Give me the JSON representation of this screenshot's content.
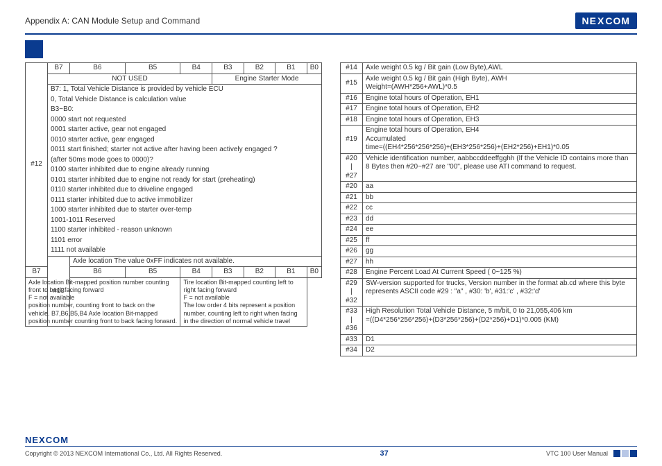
{
  "header": {
    "title": "Appendix A: CAN Module Setup and Command",
    "brand": "NEXCOM"
  },
  "bits": [
    "B7",
    "B6",
    "B5",
    "B4",
    "B3",
    "B2",
    "B1",
    "B0"
  ],
  "row12": {
    "idx": "#12",
    "subheads": {
      "left": "NOT USED",
      "right": "Engine Starter Mode"
    },
    "lines": [
      "B7: 1, Total Vehicle Distance is provided by vehicle ECU",
      "0, Total Vehicle Distance is calculation value",
      "B3~B0:",
      "0000 start not requested",
      "0001 starter active, gear not engaged",
      "0010 starter active, gear engaged",
      "0011 start finished; starter not active after having been actively engaged ?",
      "(after 50ms mode goes to 0000)?",
      "0100 starter inhibited due to engine already running",
      "0101 starter inhibited due to engine not ready for start (preheating)",
      "0110 starter inhibited due to driveline engaged",
      "0111 starter inhibited due to active immobilizer",
      "1000 starter inhibited due to starter over-temp",
      "1001-1011 Reserved",
      "1100 starter inhibited - reason unknown",
      "1101 error",
      "1111 not available"
    ]
  },
  "row13": {
    "idx": "#13",
    "headline": "Axle location The value 0xFF indicates not available.",
    "leftText": "Axle location Bit-mapped position number counting front to back facing forward\nF = not available\nposition number, counting front to back on the vehicle. B7,B6,B5,B4 Axle location Bit-mapped position number counting front to back facing forward.",
    "rightText": "Tire location Bit-mapped counting left to right facing forward\nF = not available\nThe low order 4 bits represent a position number, counting left to right when facing in the direction of normal vehicle travel"
  },
  "rightRows": [
    {
      "idx": "#14",
      "text": "Axle weight 0.5 kg / Bit gain (Low Byte),AWL"
    },
    {
      "idx": "#15",
      "text": "Axle weight 0.5 kg / Bit gain (High Byte), AWH\nWeight=(AWH*256+AWL)*0.5"
    },
    {
      "idx": "#16",
      "text": "Engine total hours of Operation, EH1"
    },
    {
      "idx": "#17",
      "text": "Engine total hours of Operation, EH2"
    },
    {
      "idx": "#18",
      "text": "Engine total hours of Operation, EH3"
    },
    {
      "idx": "#19",
      "text": "Engine total hours of Operation, EH4\nAccumulated\ntime=((EH4*256*256*256)+(EH3*256*256)+(EH2*256)+EH1)*0.05"
    },
    {
      "idx": "#20\n|\n#27",
      "text": "Vehicle identification number, aabbccddeeffgghh (If the Vehicle ID contains more than 8 Bytes then #20~#27 are \"00\", please use ATI command to request."
    },
    {
      "idx": "#20",
      "text": "aa"
    },
    {
      "idx": "#21",
      "text": "bb"
    },
    {
      "idx": "#22",
      "text": "cc"
    },
    {
      "idx": "#23",
      "text": "dd"
    },
    {
      "idx": "#24",
      "text": "ee"
    },
    {
      "idx": "#25",
      "text": "ff"
    },
    {
      "idx": "#26",
      "text": "gg"
    },
    {
      "idx": "#27",
      "text": "hh"
    },
    {
      "idx": "#28",
      "text": "Engine Percent Load At Current Speed ( 0~125 %)"
    },
    {
      "idx": "#29\n|\n#32",
      "text": "SW-version supported for trucks, Version number in the format ab.cd where this byte represents ASCII code #29 : \"a\" , #30: 'b', #31:'c' , #32:'d'"
    },
    {
      "idx": "#33\n|\n#36",
      "text": "High Resolution Total Vehicle Distance, 5 m/bit, 0 to 21,055,406 km\n=((D4*256*256*256)+(D3*256*256)+(D2*256)+D1)*0.005 (KM)"
    },
    {
      "idx": "#33",
      "text": "D1"
    },
    {
      "idx": "#34",
      "text": "D2"
    }
  ],
  "footer": {
    "brand": "NEXCOM",
    "copyright": "Copyright © 2013 NEXCOM International Co., Ltd. All Rights Reserved.",
    "page": "37",
    "manual": "VTC 100 User Manual"
  }
}
